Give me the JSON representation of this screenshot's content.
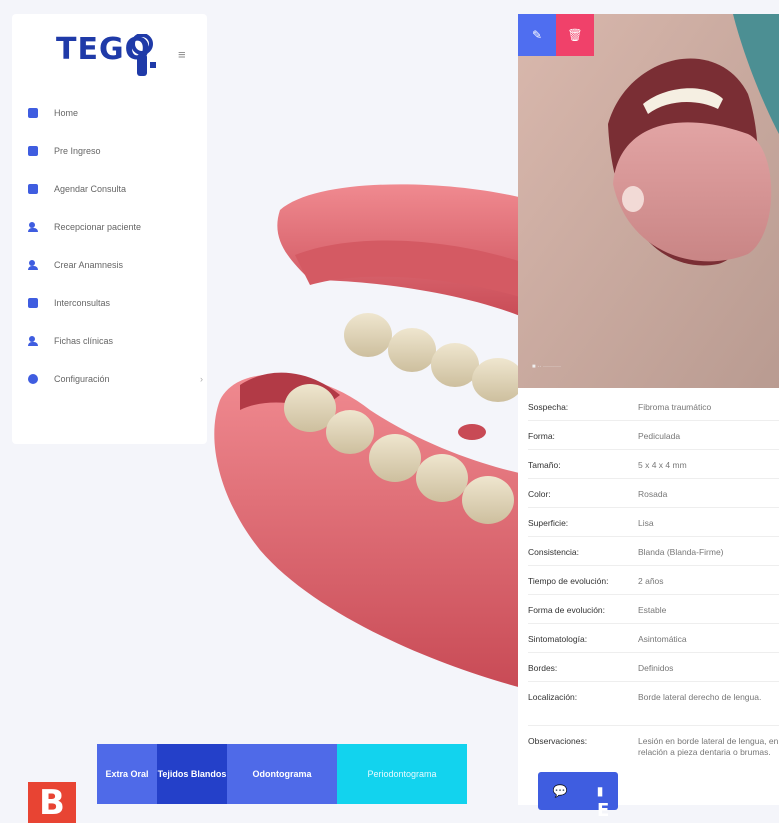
{
  "brand": {
    "logo_text": "TEGO"
  },
  "sidebar": {
    "items": [
      {
        "label": "Home",
        "icon": "home-icon"
      },
      {
        "label": "Pre Ingreso",
        "icon": "clipboard-icon"
      },
      {
        "label": "Agendar Consulta",
        "icon": "calendar-icon"
      },
      {
        "label": "Recepcionar paciente",
        "icon": "user-icon"
      },
      {
        "label": "Crear Anamnesis",
        "icon": "user-icon"
      },
      {
        "label": "Interconsultas",
        "icon": "calendar-icon"
      },
      {
        "label": "Fichas clínicas",
        "icon": "user-icon"
      },
      {
        "label": "Configuración",
        "icon": "gear-icon",
        "chevron": "›"
      }
    ]
  },
  "panel": {
    "photo_caption": "■ ·· ·········",
    "details": [
      {
        "key": "Sospecha:",
        "value": "Fibroma traumático"
      },
      {
        "key": "Forma:",
        "value": "Pediculada"
      },
      {
        "key": "Tamaño:",
        "value": "5 x 4 x 4 mm"
      },
      {
        "key": "Color:",
        "value": "Rosada"
      },
      {
        "key": "Superficie:",
        "value": "Lisa"
      },
      {
        "key": "Consistencia:",
        "value": "Blanda (Blanda-Firme)"
      },
      {
        "key": "Tiempo de evolución:",
        "value": "2 años"
      },
      {
        "key": "Forma de evolución:",
        "value": "Estable"
      },
      {
        "key": "Sintomatología:",
        "value": "Asintomática"
      },
      {
        "key": "Bordes:",
        "value": "Definidos"
      },
      {
        "key": "Localización:",
        "value": "Borde lateral derecho de lengua."
      },
      {
        "key": "Observaciones:",
        "value": "Lesión en borde lateral de lengua, en relación a pieza dentaria o brumas."
      }
    ]
  },
  "tabs": [
    {
      "label": "Extra Oral"
    },
    {
      "label": "Tejidos Blandos"
    },
    {
      "label": "Odontograma"
    },
    {
      "label": "Periodontograma"
    }
  ],
  "labels": {
    "corner": "B",
    "fab": "E"
  },
  "colors": {
    "primary": "#3f5de0",
    "danger": "#f0416a",
    "accent": "#12d3ee",
    "gum": "#e0646c"
  }
}
